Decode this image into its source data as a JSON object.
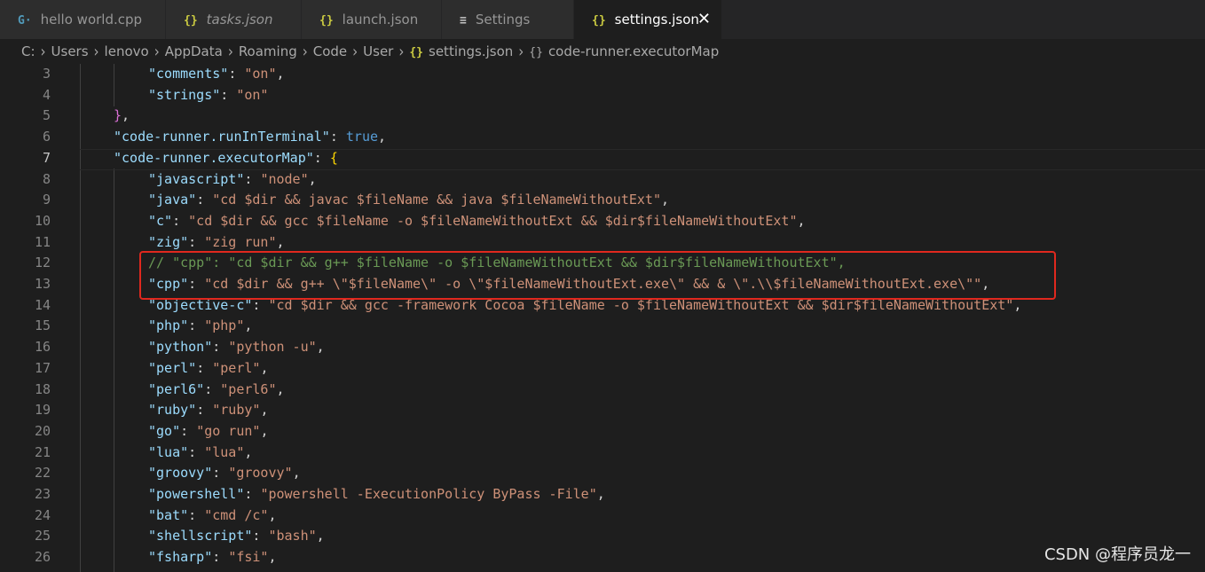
{
  "tabs": [
    {
      "label": "hello world.cpp",
      "icon": "G·",
      "icon_name": "cpp-file-icon",
      "icon_color": "#519aba",
      "italic": false,
      "active": false
    },
    {
      "label": "tasks.json",
      "icon": "{}",
      "icon_name": "json-file-icon",
      "icon_color": "#cbcb41",
      "italic": true,
      "active": false
    },
    {
      "label": "launch.json",
      "icon": "{}",
      "icon_name": "json-file-icon",
      "icon_color": "#cbcb41",
      "italic": false,
      "active": false
    },
    {
      "label": "Settings",
      "icon": "≡",
      "icon_name": "settings-list-icon",
      "icon_color": "#c5c5c5",
      "italic": false,
      "active": false
    },
    {
      "label": "settings.json",
      "icon": "{}",
      "icon_name": "json-file-icon",
      "icon_color": "#cbcb41",
      "italic": false,
      "active": true
    }
  ],
  "close_glyph": "✕",
  "breadcrumb": {
    "parts": [
      "C:",
      "Users",
      "lenovo",
      "AppData",
      "Roaming",
      "Code",
      "User",
      "settings.json",
      "code-runner.executorMap"
    ]
  },
  "current_line": "7",
  "lines": [
    {
      "n": "3",
      "indent": 2,
      "tokens": [
        [
          "key",
          "\"comments\""
        ],
        [
          "pun",
          ": "
        ],
        [
          "str",
          "\"on\""
        ],
        [
          "pun",
          ","
        ]
      ]
    },
    {
      "n": "4",
      "indent": 2,
      "tokens": [
        [
          "key",
          "\"strings\""
        ],
        [
          "pun",
          ": "
        ],
        [
          "str",
          "\"on\""
        ]
      ]
    },
    {
      "n": "5",
      "indent": 1,
      "tokens": [
        [
          "brk",
          "}"
        ],
        [
          "pun",
          ","
        ]
      ]
    },
    {
      "n": "6",
      "indent": 1,
      "tokens": [
        [
          "key",
          "\"code-runner.runInTerminal\""
        ],
        [
          "pun",
          ": "
        ],
        [
          "kw",
          "true"
        ],
        [
          "pun",
          ","
        ]
      ]
    },
    {
      "n": "7",
      "indent": 1,
      "tokens": [
        [
          "key",
          "\"code-runner.executorMap\""
        ],
        [
          "pun",
          ": "
        ],
        [
          "brk2",
          "{"
        ]
      ]
    },
    {
      "n": "8",
      "indent": 2,
      "tokens": [
        [
          "key",
          "\"javascript\""
        ],
        [
          "pun",
          ": "
        ],
        [
          "str",
          "\"node\""
        ],
        [
          "pun",
          ","
        ]
      ]
    },
    {
      "n": "9",
      "indent": 2,
      "tokens": [
        [
          "key",
          "\"java\""
        ],
        [
          "pun",
          ": "
        ],
        [
          "str",
          "\"cd $dir && javac $fileName && java $fileNameWithoutExt\""
        ],
        [
          "pun",
          ","
        ]
      ]
    },
    {
      "n": "10",
      "indent": 2,
      "tokens": [
        [
          "key",
          "\"c\""
        ],
        [
          "pun",
          ": "
        ],
        [
          "str",
          "\"cd $dir && gcc $fileName -o $fileNameWithoutExt && $dir$fileNameWithoutExt\""
        ],
        [
          "pun",
          ","
        ]
      ]
    },
    {
      "n": "11",
      "indent": 2,
      "tokens": [
        [
          "key",
          "\"zig\""
        ],
        [
          "pun",
          ": "
        ],
        [
          "str",
          "\"zig run\""
        ],
        [
          "pun",
          ","
        ]
      ]
    },
    {
      "n": "12",
      "indent": 2,
      "tokens": [
        [
          "cmt",
          "// \"cpp\": \"cd $dir && g++ $fileName -o $fileNameWithoutExt && $dir$fileNameWithoutExt\","
        ]
      ]
    },
    {
      "n": "13",
      "indent": 2,
      "tokens": [
        [
          "key",
          "\"cpp\""
        ],
        [
          "pun",
          ": "
        ],
        [
          "str",
          "\"cd $dir && g++ \\\"$fileName\\\" -o \\\"$fileNameWithoutExt.exe\\\" && & \\\".\\\\$fileNameWithoutExt.exe\\\"\""
        ],
        [
          "pun",
          ","
        ]
      ]
    },
    {
      "n": "14",
      "indent": 2,
      "tokens": [
        [
          "key",
          "\"objective-c\""
        ],
        [
          "pun",
          ": "
        ],
        [
          "str",
          "\"cd $dir && gcc -framework Cocoa $fileName -o $fileNameWithoutExt && $dir$fileNameWithoutExt\""
        ],
        [
          "pun",
          ","
        ]
      ]
    },
    {
      "n": "15",
      "indent": 2,
      "tokens": [
        [
          "key",
          "\"php\""
        ],
        [
          "pun",
          ": "
        ],
        [
          "str",
          "\"php\""
        ],
        [
          "pun",
          ","
        ]
      ]
    },
    {
      "n": "16",
      "indent": 2,
      "tokens": [
        [
          "key",
          "\"python\""
        ],
        [
          "pun",
          ": "
        ],
        [
          "str",
          "\"python -u\""
        ],
        [
          "pun",
          ","
        ]
      ]
    },
    {
      "n": "17",
      "indent": 2,
      "tokens": [
        [
          "key",
          "\"perl\""
        ],
        [
          "pun",
          ": "
        ],
        [
          "str",
          "\"perl\""
        ],
        [
          "pun",
          ","
        ]
      ]
    },
    {
      "n": "18",
      "indent": 2,
      "tokens": [
        [
          "key",
          "\"perl6\""
        ],
        [
          "pun",
          ": "
        ],
        [
          "str",
          "\"perl6\""
        ],
        [
          "pun",
          ","
        ]
      ]
    },
    {
      "n": "19",
      "indent": 2,
      "tokens": [
        [
          "key",
          "\"ruby\""
        ],
        [
          "pun",
          ": "
        ],
        [
          "str",
          "\"ruby\""
        ],
        [
          "pun",
          ","
        ]
      ]
    },
    {
      "n": "20",
      "indent": 2,
      "tokens": [
        [
          "key",
          "\"go\""
        ],
        [
          "pun",
          ": "
        ],
        [
          "str",
          "\"go run\""
        ],
        [
          "pun",
          ","
        ]
      ]
    },
    {
      "n": "21",
      "indent": 2,
      "tokens": [
        [
          "key",
          "\"lua\""
        ],
        [
          "pun",
          ": "
        ],
        [
          "str",
          "\"lua\""
        ],
        [
          "pun",
          ","
        ]
      ]
    },
    {
      "n": "22",
      "indent": 2,
      "tokens": [
        [
          "key",
          "\"groovy\""
        ],
        [
          "pun",
          ": "
        ],
        [
          "str",
          "\"groovy\""
        ],
        [
          "pun",
          ","
        ]
      ]
    },
    {
      "n": "23",
      "indent": 2,
      "tokens": [
        [
          "key",
          "\"powershell\""
        ],
        [
          "pun",
          ": "
        ],
        [
          "str",
          "\"powershell -ExecutionPolicy ByPass -File\""
        ],
        [
          "pun",
          ","
        ]
      ]
    },
    {
      "n": "24",
      "indent": 2,
      "tokens": [
        [
          "key",
          "\"bat\""
        ],
        [
          "pun",
          ": "
        ],
        [
          "str",
          "\"cmd /c\""
        ],
        [
          "pun",
          ","
        ]
      ]
    },
    {
      "n": "25",
      "indent": 2,
      "tokens": [
        [
          "key",
          "\"shellscript\""
        ],
        [
          "pun",
          ": "
        ],
        [
          "str",
          "\"bash\""
        ],
        [
          "pun",
          ","
        ]
      ]
    },
    {
      "n": "26",
      "indent": 2,
      "tokens": [
        [
          "key",
          "\"fsharp\""
        ],
        [
          "pun",
          ": "
        ],
        [
          "str",
          "\"fsi\""
        ],
        [
          "pun",
          ","
        ]
      ]
    }
  ],
  "watermark": "CSDN @程序员龙一",
  "colors": {
    "background": "#1e1e1e",
    "tabbar": "#252526",
    "key": "#9cdcfe",
    "string": "#ce9178",
    "keyword": "#569cd6",
    "comment": "#6a9955",
    "highlight_box": "#e0281e"
  }
}
